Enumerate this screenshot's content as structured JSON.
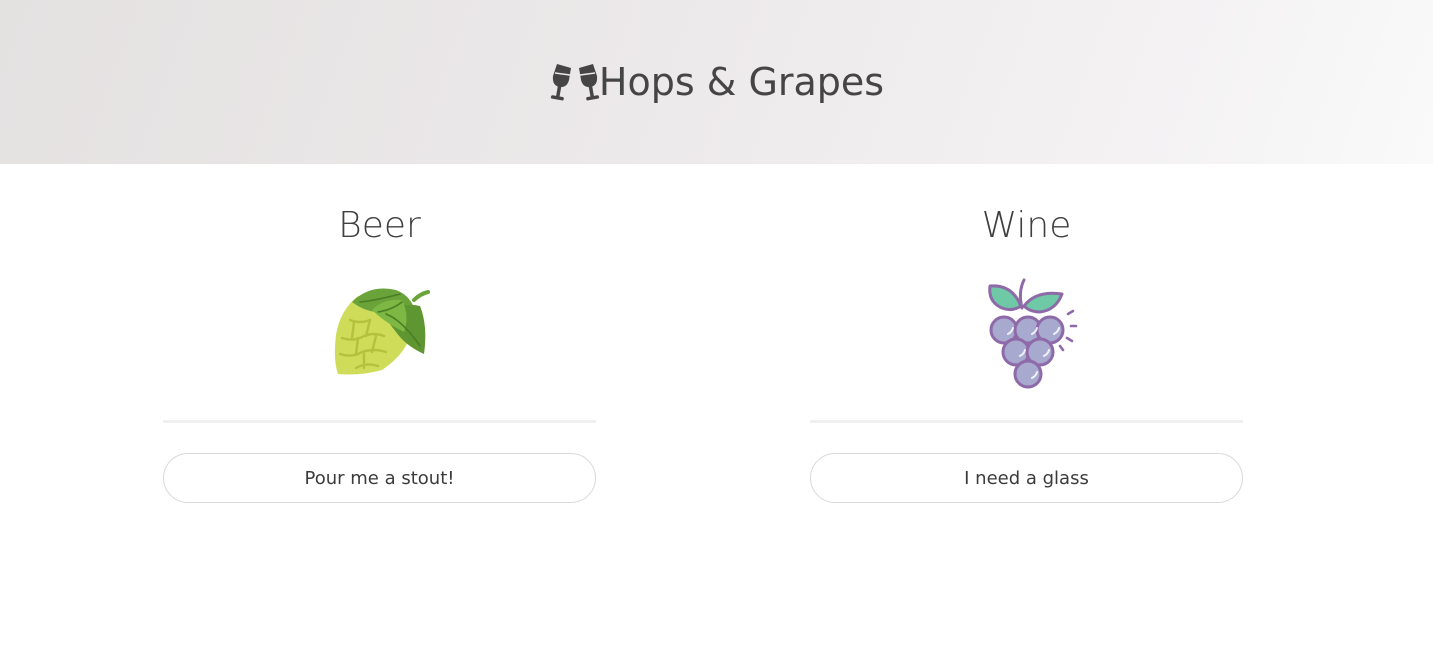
{
  "header": {
    "title": "Hops & Grapes",
    "logo_icon": "clinking-glasses-icon"
  },
  "columns": [
    {
      "title": "Beer",
      "illustration": "hop-cone-icon",
      "button_label": "Pour me a stout!"
    },
    {
      "title": "Wine",
      "illustration": "grapes-icon",
      "button_label": "I need a glass"
    }
  ],
  "colors": {
    "text": "#454545",
    "header_gradient_start": "#e4e1e1",
    "header_gradient_end": "#fafafa",
    "hop_light": "#cfdc5a",
    "hop_leaf": "#6aa33a",
    "grape_fill": "#a7a9cf",
    "grape_outline": "#8e6aa8",
    "grape_leaf": "#6fc9a7"
  }
}
